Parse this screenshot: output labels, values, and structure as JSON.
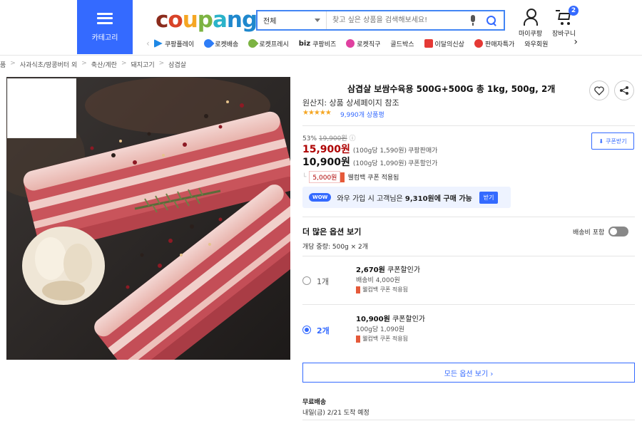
{
  "header": {
    "category_label": "카테고리",
    "logo_letters": [
      "c",
      "o",
      "u",
      "p",
      "a",
      "ng"
    ],
    "search": {
      "scope": "전체",
      "placeholder": "찾고 싶은 상품을 검색해보세요!"
    },
    "mycoupang_label": "마이쿠팡",
    "cart_label": "장바구니",
    "cart_count": "2",
    "quick_links": [
      {
        "label": "쿠팡플레이",
        "icon": "play-icon",
        "color": "#1e88e5"
      },
      {
        "label": "로켓배송",
        "icon": "rocket-icon",
        "color": "#2e7df7"
      },
      {
        "label": "로켓프레시",
        "icon": "rocket-fresh-icon",
        "color": "#7cb342"
      },
      {
        "label": "쿠팡비즈",
        "icon": "biz-icon",
        "color": "#111111",
        "prefix": "biz"
      },
      {
        "label": "로켓직구",
        "icon": "global-icon",
        "color": "#e040a0"
      },
      {
        "label": "골드박스",
        "icon": "",
        "color": ""
      },
      {
        "label": "이달의신상",
        "icon": "bag-icon",
        "color": "#e53935"
      },
      {
        "label": "판매자특가",
        "icon": "percent-icon",
        "color": "#e53935"
      },
      {
        "label": "와우회원",
        "icon": "",
        "color": ""
      }
    ]
  },
  "breadcrumb": [
    "품",
    "사과식초/땅콩버터 외",
    "축산/계란",
    "돼지고기",
    "삼겹살"
  ],
  "product": {
    "title": "삼겹살 보쌈수육용 500G+500G 총 1kg, 500g, 2개",
    "origin": "원산지: 상품 상세페이지 참조",
    "stars": "★★★★★",
    "rating": 4.5,
    "review_count": "9,990개 상품평",
    "discount_rate": "53%",
    "original_price": "19,900원",
    "sale_price": "15,900원",
    "sale_unit": "(100g당 1,590원)",
    "sale_tag": "쿠팡판매가",
    "coupon_price": "10,900원",
    "coupon_unit": "(100g당 1,090원)",
    "coupon_tag": "쿠폰할인가",
    "coupon_download_label": "쿠폰받기",
    "coupon_amount": "5,000원",
    "coupon_text": "웰컴백 쿠폰 적용됨",
    "wow": {
      "badge": "WOW",
      "text_prefix": "와우 가입 시 고객님은 ",
      "text_price": "9,310원에 구매 가능",
      "button": "받기"
    }
  },
  "options": {
    "title": "더 많은 옵션 보기",
    "shipping_toggle_label": "배송비 포함",
    "unit_weight": "개당 중량: 500g × 2개",
    "items": [
      {
        "qty": "1개",
        "selected": false,
        "price": "2,670원",
        "price_tag": "쿠폰할인가",
        "sub": "배송비 4,000원",
        "coupon": "웰컴백 쿠폰 적용됨"
      },
      {
        "qty": "2개",
        "selected": true,
        "price": "10,900원",
        "price_tag": "쿠폰할인가",
        "sub": "100g당 1,090원",
        "coupon": "웰컴백 쿠폰 적용됨"
      }
    ],
    "all_options_button": "모든 옵션 보기 ›"
  },
  "delivery": {
    "free_label": "무료배송",
    "arrival": "내일(금) 2/21 도착 예정"
  },
  "colors": {
    "accent": "#346aff",
    "price_red": "#ae0000"
  }
}
